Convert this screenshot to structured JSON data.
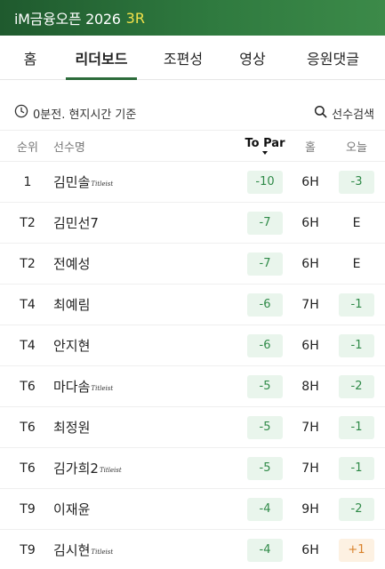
{
  "header": {
    "title": "iM금융오픈 2026",
    "round": "3R"
  },
  "tabs": [
    {
      "label": "홈",
      "active": false
    },
    {
      "label": "리더보드",
      "active": true
    },
    {
      "label": "조편성",
      "active": false
    },
    {
      "label": "영상",
      "active": false
    },
    {
      "label": "응원댓글",
      "active": false
    }
  ],
  "meta": {
    "updated": "0분전. 현지시간 기준",
    "search": "선수검색"
  },
  "columns": {
    "rank": "순위",
    "name": "선수명",
    "to_par": "To Par",
    "hole": "홀",
    "today": "오늘"
  },
  "players": [
    {
      "rank": "1",
      "name": "김민솔",
      "logo": "Titleist",
      "to_par": "-10",
      "hole": "6H",
      "today": "-3"
    },
    {
      "rank": "T2",
      "name": "김민선7",
      "logo": "",
      "to_par": "-7",
      "hole": "6H",
      "today": "E"
    },
    {
      "rank": "T2",
      "name": "전예성",
      "logo": "",
      "to_par": "-7",
      "hole": "6H",
      "today": "E"
    },
    {
      "rank": "T4",
      "name": "최예림",
      "logo": "",
      "to_par": "-6",
      "hole": "7H",
      "today": "-1"
    },
    {
      "rank": "T4",
      "name": "안지현",
      "logo": "",
      "to_par": "-6",
      "hole": "6H",
      "today": "-1"
    },
    {
      "rank": "T6",
      "name": "마다솜",
      "logo": "Titleist",
      "to_par": "-5",
      "hole": "8H",
      "today": "-2"
    },
    {
      "rank": "T6",
      "name": "최정원",
      "logo": "",
      "to_par": "-5",
      "hole": "7H",
      "today": "-1"
    },
    {
      "rank": "T6",
      "name": "김가희2",
      "logo": "Titleist",
      "to_par": "-5",
      "hole": "7H",
      "today": "-1"
    },
    {
      "rank": "T9",
      "name": "이재윤",
      "logo": "",
      "to_par": "-4",
      "hole": "9H",
      "today": "-2"
    },
    {
      "rank": "T9",
      "name": "김시현",
      "logo": "Titleist",
      "to_par": "-4",
      "hole": "6H",
      "today": "+1"
    }
  ],
  "colors": {
    "header_bg": "#2f7a3f",
    "accent": "#2c6b3a",
    "round": "#f2e14a",
    "under_par": "#2f8a48",
    "over_par": "#d9822b"
  }
}
